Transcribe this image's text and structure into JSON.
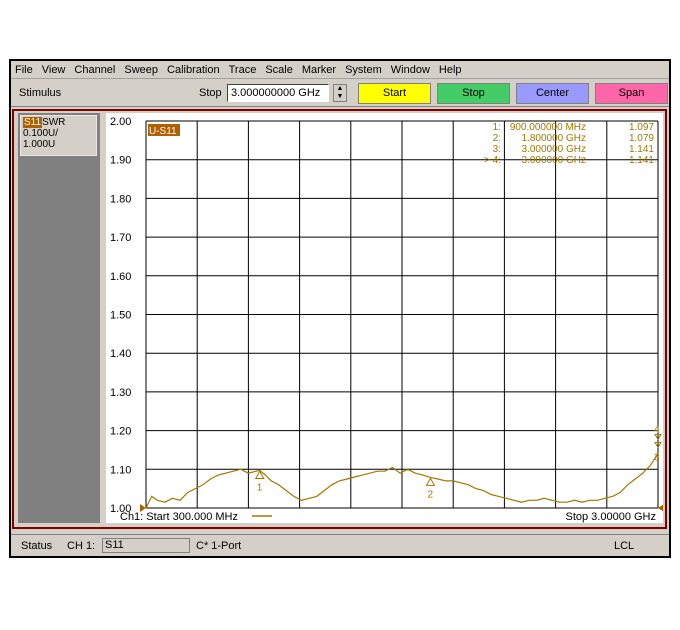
{
  "menu": [
    "File",
    "View",
    "Channel",
    "Sweep",
    "Calibration",
    "Trace",
    "Scale",
    "Marker",
    "System",
    "Window",
    "Help"
  ],
  "toolbar": {
    "stimulus_label": "Stimulus",
    "stop_label": "Stop",
    "stop_value": "3.000000000 GHz",
    "start_button": "Start",
    "stop_button": "Stop",
    "center_button": "Center",
    "span_button": "Span"
  },
  "trace_panel": {
    "trace": "S11",
    "format": "SWR",
    "scale": "0.100U/",
    "ref": "1.000U"
  },
  "chart_data": {
    "type": "line",
    "trace_tag": "U-S11",
    "ylim": [
      1.0,
      2.0
    ],
    "yticks": [
      "2.00",
      "1.90",
      "1.80",
      "1.70",
      "1.60",
      "1.50",
      "1.40",
      "1.30",
      "1.20",
      "1.10",
      "1.00"
    ],
    "xlim": [
      300,
      3000
    ],
    "x_unit": "MHz",
    "grid": true,
    "start_label": "Ch1: Start  300.000 MHz",
    "stop_label": "Stop  3.00000 GHz",
    "series": [
      {
        "color": "#a07800",
        "x": [
          300,
          330,
          360,
          400,
          440,
          480,
          520,
          560,
          600,
          640,
          680,
          720,
          760,
          800,
          840,
          880,
          900,
          930,
          960,
          1000,
          1040,
          1080,
          1120,
          1160,
          1200,
          1240,
          1280,
          1320,
          1360,
          1400,
          1440,
          1480,
          1520,
          1560,
          1600,
          1640,
          1680,
          1720,
          1760,
          1800,
          1840,
          1880,
          1920,
          1960,
          2000,
          2040,
          2080,
          2120,
          2160,
          2200,
          2240,
          2280,
          2320,
          2360,
          2400,
          2440,
          2480,
          2520,
          2560,
          2600,
          2640,
          2680,
          2720,
          2760,
          2800,
          2840,
          2880,
          2920,
          2960,
          3000
        ],
        "values": [
          1.0,
          1.03,
          1.02,
          1.015,
          1.025,
          1.02,
          1.04,
          1.05,
          1.06,
          1.075,
          1.085,
          1.09,
          1.095,
          1.1,
          1.09,
          1.095,
          1.097,
          1.085,
          1.07,
          1.06,
          1.045,
          1.03,
          1.02,
          1.025,
          1.03,
          1.045,
          1.06,
          1.07,
          1.075,
          1.08,
          1.085,
          1.09,
          1.095,
          1.095,
          1.105,
          1.09,
          1.1,
          1.09,
          1.085,
          1.079,
          1.075,
          1.07,
          1.07,
          1.065,
          1.06,
          1.05,
          1.045,
          1.035,
          1.03,
          1.025,
          1.02,
          1.015,
          1.02,
          1.02,
          1.025,
          1.02,
          1.015,
          1.015,
          1.02,
          1.015,
          1.02,
          1.02,
          1.025,
          1.03,
          1.04,
          1.06,
          1.075,
          1.09,
          1.11,
          1.141
        ]
      }
    ],
    "markers": [
      {
        "num": "1",
        "x": 900,
        "value": 1.097,
        "freq": "900.000000 MHz",
        "val_text": "1.097"
      },
      {
        "num": "2",
        "x": 1800,
        "value": 1.079,
        "freq": "1.800000 GHz",
        "val_text": "1.079"
      },
      {
        "num": "3",
        "x": 3000,
        "value": 1.141,
        "freq": "3.000000 GHz",
        "val_text": "1.141"
      },
      {
        "num": "4",
        "x": 3000,
        "value": 1.141,
        "freq": "3.000000 GHz",
        "val_text": "1.141",
        "active": true
      }
    ]
  },
  "status": {
    "label": "Status",
    "channel": "CH 1:",
    "param": "S11",
    "mode": "C* 1-Port",
    "remote": "LCL"
  }
}
